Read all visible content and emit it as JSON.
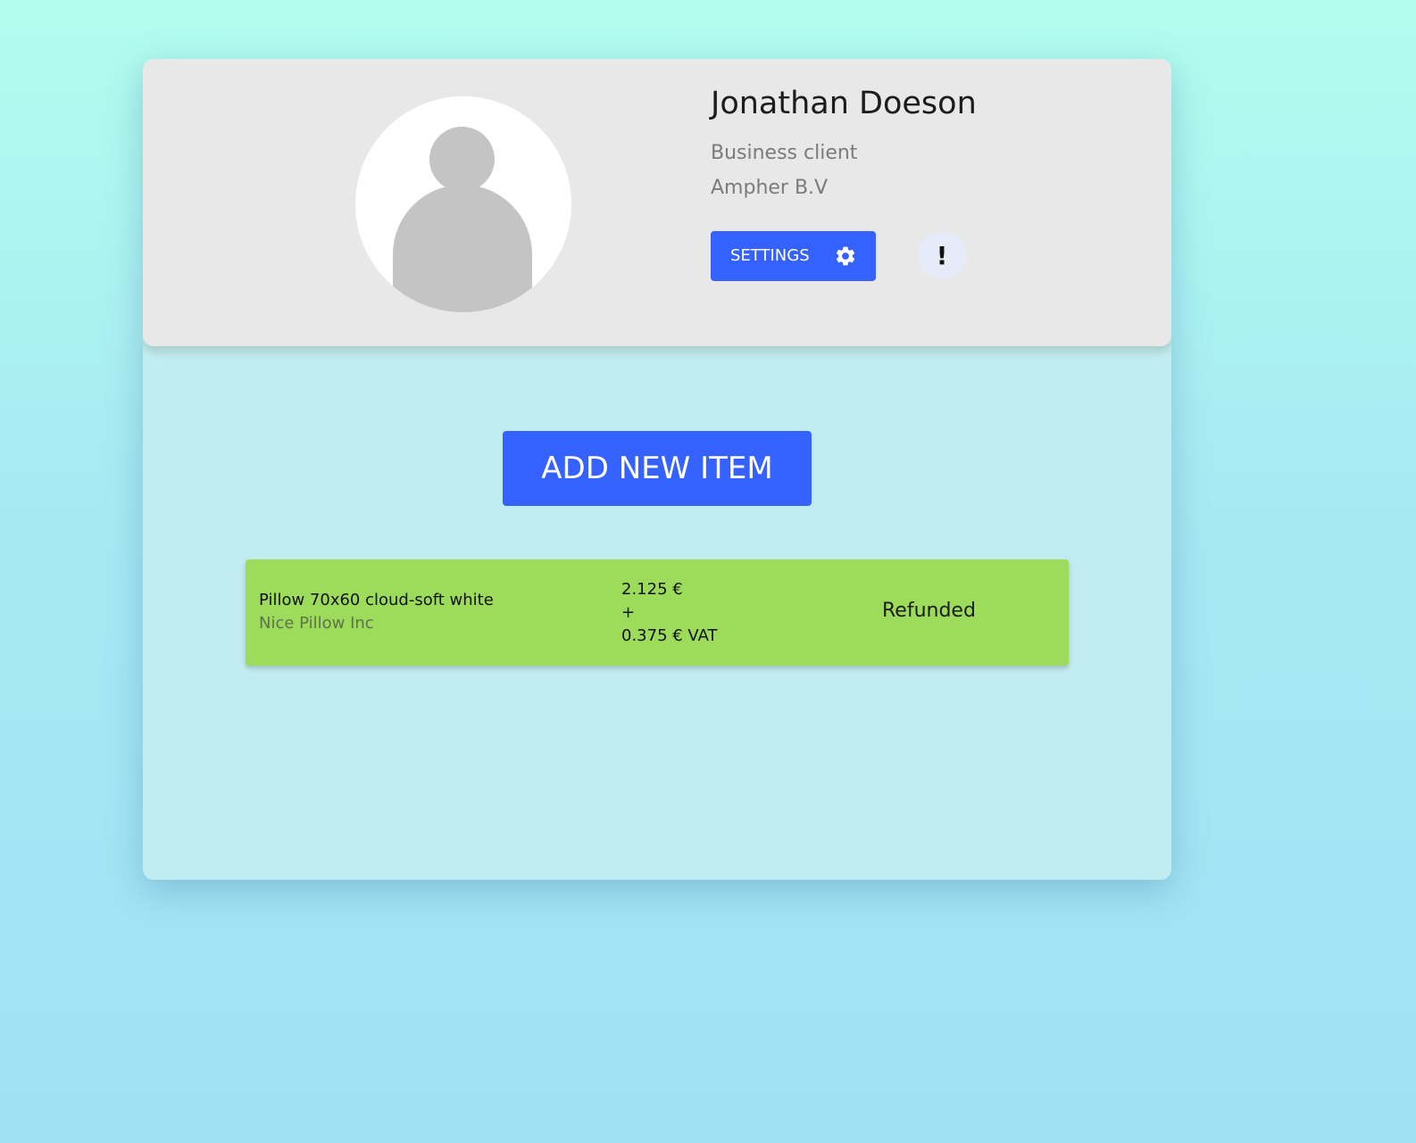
{
  "profile": {
    "name": "Jonathan Doeson",
    "role": "Business client",
    "company": "Ampher B.V",
    "settings_label": "SETTINGS",
    "settings_icon": "gear-icon",
    "alert_label": "!",
    "avatar_icon": "user-silhouette-icon"
  },
  "actions": {
    "add_item_label": "ADD NEW ITEM"
  },
  "items": [
    {
      "name": "Pillow 70x60 cloud-soft white",
      "vendor": "Nice Pillow Inc",
      "price": "2.125 €",
      "plus": "+",
      "vat": "0.375 € VAT",
      "status": "Refunded",
      "status_color": "#9cdc5a"
    }
  ],
  "colors": {
    "accent": "#3561ff",
    "card_bg": "#c2edf0",
    "profile_bg": "#e8e8e9",
    "avatar_fill": "#c4c4c4"
  }
}
